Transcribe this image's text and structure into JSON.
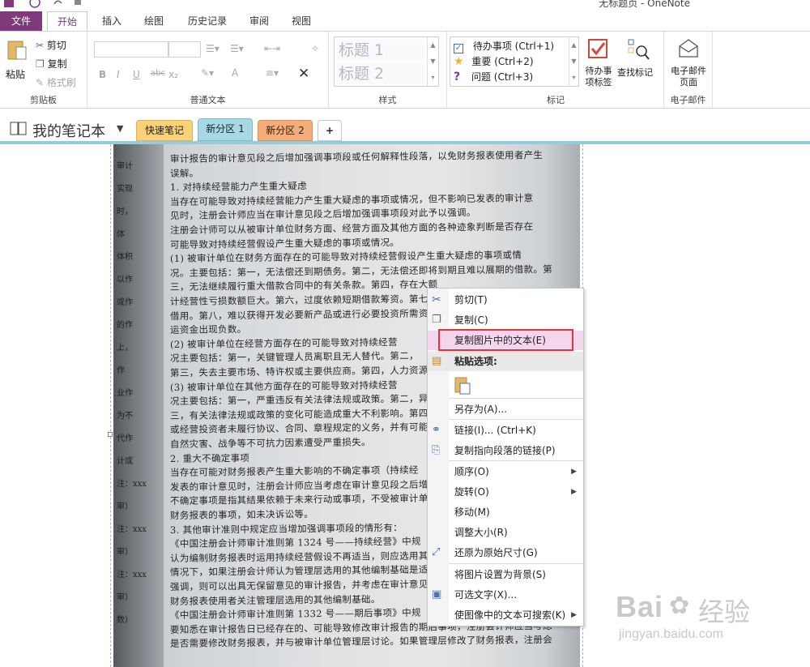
{
  "window": {
    "title": "无标题页 - OneNote"
  },
  "ribbon_tabs": [
    "文件",
    "开始",
    "插入",
    "绘图",
    "历史记录",
    "审阅",
    "视图"
  ],
  "clipboard": {
    "paste": "粘贴",
    "cut": "剪切",
    "copy": "复制",
    "format_painter": "格式刷",
    "label": "剪贴板"
  },
  "basic_text": {
    "label": "普通文本",
    "bold": "B",
    "italic": "I",
    "underline": "U",
    "strike": "abc",
    "sub": "x₂",
    "font_color": "A"
  },
  "styles": {
    "label": "样式",
    "h1": "标题 1",
    "h2": "标题 2"
  },
  "tags": {
    "label": "标记",
    "items": [
      "待办事项 (Ctrl+1)",
      "重要 (Ctrl+2)",
      "问题 (Ctrl+3)"
    ],
    "todo_tag": "待办事项标签",
    "find_tags": "查找标记"
  },
  "email": {
    "button": "电子邮件页面",
    "label": "电子邮件"
  },
  "notebook": {
    "name": "我的笔记本",
    "sections": [
      "快速笔记",
      "新分区 1",
      "新分区 2"
    ],
    "add": "+"
  },
  "scan_text": {
    "lines": [
      "审计报告的审计意见段之后增加强调事项段或任何解释性段落，以免财务报表使用者产生",
      "误解。",
      "1. 对持续经营能力产生重大疑虑",
      "当存在可能导致对持续经营能力产生重大疑虑的事项或情况，但不影响已发表的审计意",
      "见时，注册会计师应当在审计意见段之后增加强调事项段对此予以强调。",
      "注册会计师可以从被审计单位财务方面、经营方面及其他方面的各种迹象判断是否存在",
      "可能导致对持续经营假设产生重大疑虑的事项或情况。",
      "(1) 被审计单位在财务方面存在的可能导致对持续经营假设产生重大疑虑的事项或情",
      "况。主要包括：第一，无法偿还到期债务。第二，无法偿还即将到期且难以展期的借款。第",
      "三，无法继续履行重大借款合同中的有关条款。第四，存在大额",
      "计经营性亏损数额巨大。第六，过度依赖短期借款筹资。第七，",
      "借用。第八，难以获得开发必要新产品或进行必要投资所需资金",
      "运资金出现负数。",
      "(2) 被审计单位在经营方面存在的可能导致对持续经营",
      "况主要包括：第一，关键管理人员离职且无人替代。第二，",
      "第三，失去主要市场、特许权或主要供应商。第四，人力资源",
      "(3) 被审计单位在其他方面存在的可能导致对持续经营",
      "况主要包括：第一，严重违反有关法律法规或政策。第二，异",
      "三，有关法律法规或政策的变化可能造成重大不利影响。第四，",
      "或经营投资者未履行协议、合同、章程规定的义务，并有可能造",
      "自然灾害、战争等不可抗力因素遭受严重损失。",
      "2. 重大不确定事项",
      "当存在可能对财务报表产生重大影响的不确定事项（持续经",
      "发表的审计意见时，注册会计师应当考虑在审计意见段之后增加",
      "不确定事项是指其结果依赖于未来行动或事项，不受被审计单位",
      "财务报表的事项，如未决诉讼等。",
      "3. 其他审计准则中规定应当增加强调事项段的情形有：",
      "《中国注册会计师审计准则第 1324 号——持续经营》中规",
      "认为编制财务报表时运用持续经营假设不再适当，则应选用其他",
      "情况下，如果注册会计师认为管理层选用的其他编制基础是适当",
      "强调，则可以出具无保留意见的审计报告，并考虑在审计意见段",
      "财务报表使用者关注管理层选用的其他编制基础。",
      "《中国注册会计师审计准则第 1332 号——期后事项》中规",
      "要知悉在审计报告日已经存在的、可能导致修改审计报告的期后事项，注册会计师应当考虑",
      "是否需要修改财务报表，并与被审计单位管理层讨论。如果管理层修改了财务报表，注册会"
    ],
    "left_fragments": [
      "审计",
      "实现",
      "时，",
      "体",
      "体积",
      "以作",
      "或作",
      "的作",
      "上，",
      "作",
      "业作",
      "为不",
      "代作",
      "计或",
      "注：xxx",
      "审）",
      "注：xxx",
      "审）",
      "注：xxx",
      "审）",
      "数）"
    ]
  },
  "context_menu": {
    "items": [
      {
        "label": "剪切(T)",
        "icon": "scissors-icon"
      },
      {
        "label": "复制(C)",
        "icon": "copy-icon"
      },
      {
        "label": "复制图片中的文本(E)",
        "icon": ""
      },
      {
        "label": "粘贴选项:",
        "icon": "paste-icon"
      },
      {
        "label": "另存为(A)...",
        "icon": ""
      },
      {
        "label": "链接(I)...  (Ctrl+K)",
        "icon": "link-icon"
      },
      {
        "label": "复制指向段落的链接(P)",
        "icon": "link-paragraph-icon"
      },
      {
        "label": "顺序(O)",
        "icon": ""
      },
      {
        "label": "旋转(O)",
        "icon": ""
      },
      {
        "label": "移动(M)",
        "icon": ""
      },
      {
        "label": "调整大小(R)",
        "icon": ""
      },
      {
        "label": "还原为原始尺寸(G)",
        "icon": "restore-size-icon"
      },
      {
        "label": "将图片设置为背景(S)",
        "icon": ""
      },
      {
        "label": "可选文字(X)...",
        "icon": "alt-text-icon"
      },
      {
        "label": "使图像中的文本可搜索(K)",
        "icon": ""
      }
    ]
  },
  "watermark": {
    "brand": "Bai",
    "cn": "经验",
    "url": "jingyan.baidu.com"
  },
  "colors": {
    "file_tab": "#80397b",
    "section_blue": "#94ccd7",
    "highlight": "#e0353a"
  }
}
